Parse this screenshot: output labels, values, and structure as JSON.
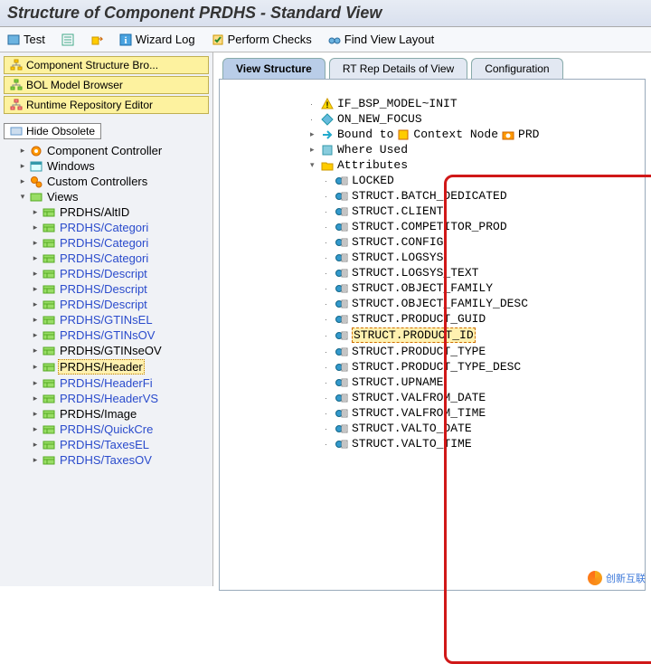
{
  "title": "Structure of Component PRDHS - Standard View",
  "toolbar": {
    "test": "Test",
    "wizard_log": "Wizard Log",
    "perform_checks": "Perform Checks",
    "find_view_layout": "Find View Layout"
  },
  "left": {
    "buttons": {
      "component_structure": "Component Structure Bro...",
      "bol_model": "BOL Model Browser",
      "runtime_repo": "Runtime Repository Editor"
    },
    "hide_obsolete": "Hide Obsolete",
    "tree": {
      "component_controller": "Component Controller",
      "windows": "Windows",
      "custom_controllers": "Custom Controllers",
      "views": "Views",
      "view_items": [
        {
          "label": "PRDHS/AltID",
          "link": false
        },
        {
          "label": "PRDHS/Categori",
          "link": true
        },
        {
          "label": "PRDHS/Categori",
          "link": true
        },
        {
          "label": "PRDHS/Categori",
          "link": true
        },
        {
          "label": "PRDHS/Descript",
          "link": true
        },
        {
          "label": "PRDHS/Descript",
          "link": true
        },
        {
          "label": "PRDHS/Descript",
          "link": true
        },
        {
          "label": "PRDHS/GTINsEL",
          "link": true
        },
        {
          "label": "PRDHS/GTINsOV",
          "link": true
        },
        {
          "label": "PRDHS/GTINseOV",
          "link": false
        },
        {
          "label": "PRDHS/Header",
          "link": false,
          "selected": true
        },
        {
          "label": "PRDHS/HeaderFi",
          "link": true
        },
        {
          "label": "PRDHS/HeaderVS",
          "link": true
        },
        {
          "label": "PRDHS/Image",
          "link": false
        },
        {
          "label": "PRDHS/QuickCre",
          "link": true
        },
        {
          "label": "PRDHS/TaxesEL",
          "link": true
        },
        {
          "label": "PRDHS/TaxesOV",
          "link": true
        }
      ]
    }
  },
  "right": {
    "tabs": {
      "view_structure": "View Structure",
      "rt_rep": "RT Rep Details of View",
      "configuration": "Configuration"
    },
    "top_nodes": {
      "if_bsp": "IF_BSP_MODEL~INIT",
      "on_new_focus": "ON_NEW_FOCUS",
      "bound_to": "Bound to",
      "context_node": "Context Node",
      "prd": "PRD",
      "where_used": "Where Used",
      "attributes": "Attributes"
    },
    "attributes": [
      {
        "label": "LOCKED"
      },
      {
        "label": "STRUCT.BATCH_DEDICATED"
      },
      {
        "label": "STRUCT.CLIENT"
      },
      {
        "label": "STRUCT.COMPETITOR_PROD"
      },
      {
        "label": "STRUCT.CONFIG"
      },
      {
        "label": "STRUCT.LOGSYS"
      },
      {
        "label": "STRUCT.LOGSYS_TEXT"
      },
      {
        "label": "STRUCT.OBJECT_FAMILY"
      },
      {
        "label": "STRUCT.OBJECT_FAMILY_DESC"
      },
      {
        "label": "STRUCT.PRODUCT_GUID"
      },
      {
        "label": "STRUCT.PRODUCT_ID",
        "highlight": true
      },
      {
        "label": "STRUCT.PRODUCT_TYPE"
      },
      {
        "label": "STRUCT.PRODUCT_TYPE_DESC"
      },
      {
        "label": "STRUCT.UPNAME"
      },
      {
        "label": "STRUCT.VALFROM_DATE"
      },
      {
        "label": "STRUCT.VALFROM_TIME"
      },
      {
        "label": "STRUCT.VALTO_DATE"
      },
      {
        "label": "STRUCT.VALTO_TIME"
      }
    ]
  },
  "watermark": "创新互联"
}
